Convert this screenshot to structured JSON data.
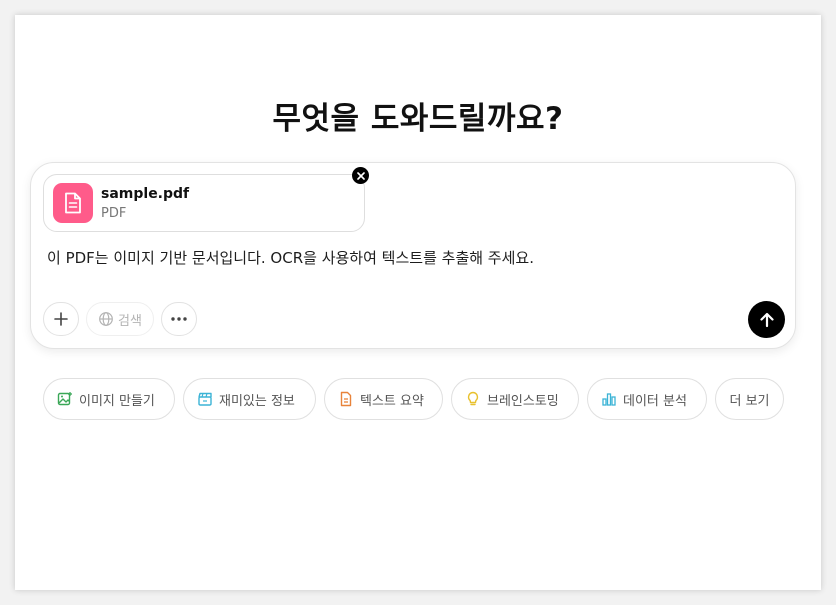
{
  "heading": "무엇을 도와드릴까요?",
  "attachment": {
    "file_name": "sample.pdf",
    "file_type": "PDF"
  },
  "prompt": "이 PDF는 이미지 기반 문서입니다. OCR을 사용하여 텍스트를 추출해 주세요.",
  "toolbar": {
    "search_label": "검색"
  },
  "suggestions": [
    {
      "label": "이미지 만들기",
      "icon": "image-icon",
      "color": "#3aa757"
    },
    {
      "label": "재미있는 정보",
      "icon": "clapperboard-icon",
      "color": "#3bb3d6"
    },
    {
      "label": "텍스트 요약",
      "icon": "document-icon",
      "color": "#e8833a"
    },
    {
      "label": "브레인스토밍",
      "icon": "lightbulb-icon",
      "color": "#e8c12e"
    },
    {
      "label": "데이터 분석",
      "icon": "bar-chart-icon",
      "color": "#3bb3d6"
    },
    {
      "label": "더 보기",
      "icon": "",
      "color": ""
    }
  ],
  "colors": {
    "file_icon_bg": "#ff5b8a",
    "send_button_bg": "#000000"
  }
}
